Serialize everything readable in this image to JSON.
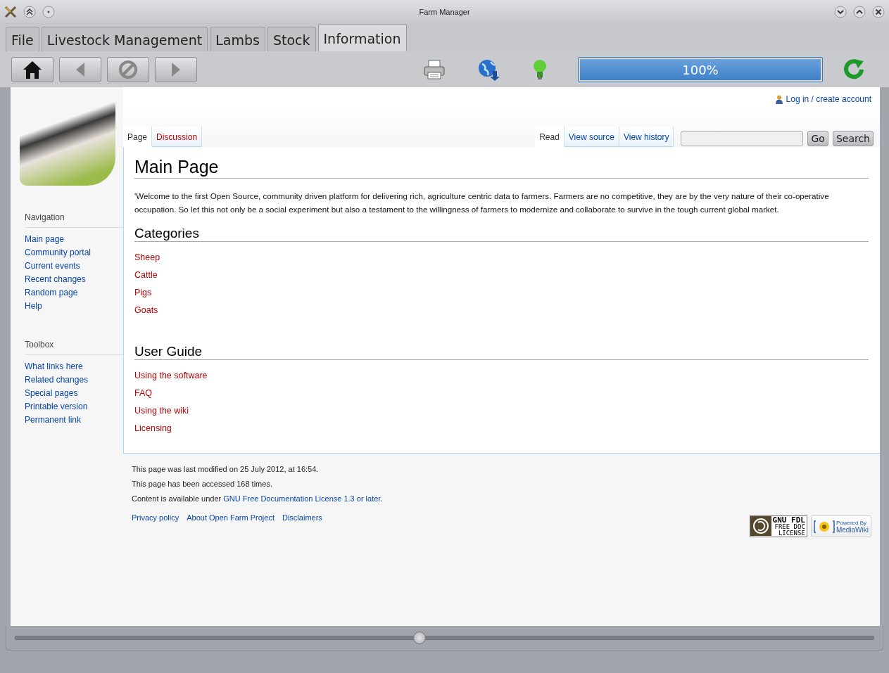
{
  "window": {
    "title": "Farm Manager"
  },
  "tabs": [
    {
      "label": "File",
      "selected": false
    },
    {
      "label": "Livestock Management",
      "selected": false
    },
    {
      "label": "Lambs",
      "selected": false
    },
    {
      "label": "Stock",
      "selected": false
    },
    {
      "label": "Information",
      "selected": true
    }
  ],
  "toolbar": {
    "progress": {
      "level": 1,
      "reading": "100%"
    }
  },
  "wiki": {
    "personal_link": "Log in / create account",
    "page_tabs": [
      {
        "label": "Page",
        "selected": true
      },
      {
        "label": "Discussion",
        "selected": false
      }
    ],
    "view_tabs": [
      {
        "label": "Read",
        "selected": true
      },
      {
        "label": "View source",
        "selected": false
      },
      {
        "label": "View history",
        "selected": false
      }
    ],
    "search": {
      "go": "Go",
      "search": "Search"
    },
    "sidebar": [
      {
        "heading": "Navigation",
        "links": [
          "Main page",
          "Community portal",
          "Current events",
          "Recent changes",
          "Random page",
          "Help"
        ]
      },
      {
        "heading": "Toolbox",
        "links": [
          "What links here",
          "Related changes",
          "Special pages",
          "Printable version",
          "Permanent link"
        ]
      }
    ],
    "title": "Main Page",
    "intro": "'Welcome to the first Open Source, community driven platform for delivering rich, agriculture centric data to farmers. Farmers are no competitive, they are by the very nature of their co-operative occupation. So let this not only be a social experiment but also a testament to the willingness of farmers to modernize and collaborate to survive in the tough current global market.",
    "sections": [
      {
        "heading": "Categories",
        "links": [
          "Sheep",
          "Cattle",
          "Pigs",
          "Goats"
        ]
      },
      {
        "heading": "User Guide",
        "links": [
          "Using the software",
          "FAQ",
          "Using the wiki",
          "Licensing"
        ]
      }
    ],
    "footer": {
      "modified": "This page was last modified on 25 July 2012, at 16:54.",
      "accessed": "This page has been accessed 168 times.",
      "license_prefix": "Content is available under",
      "license_link": "GNU Free Documentation License 1.3 or later",
      "license_suffix": ".",
      "links": [
        "Privacy policy",
        "About Open Farm Project",
        "Disclaimers"
      ],
      "gfdl_badge": [
        "GNU FDL",
        "FREE DOC",
        "LICENSE"
      ],
      "mediawiki_badge": [
        "Powered By",
        "MediaWiki"
      ]
    }
  },
  "zoom_slider": {
    "level": 0.47
  }
}
